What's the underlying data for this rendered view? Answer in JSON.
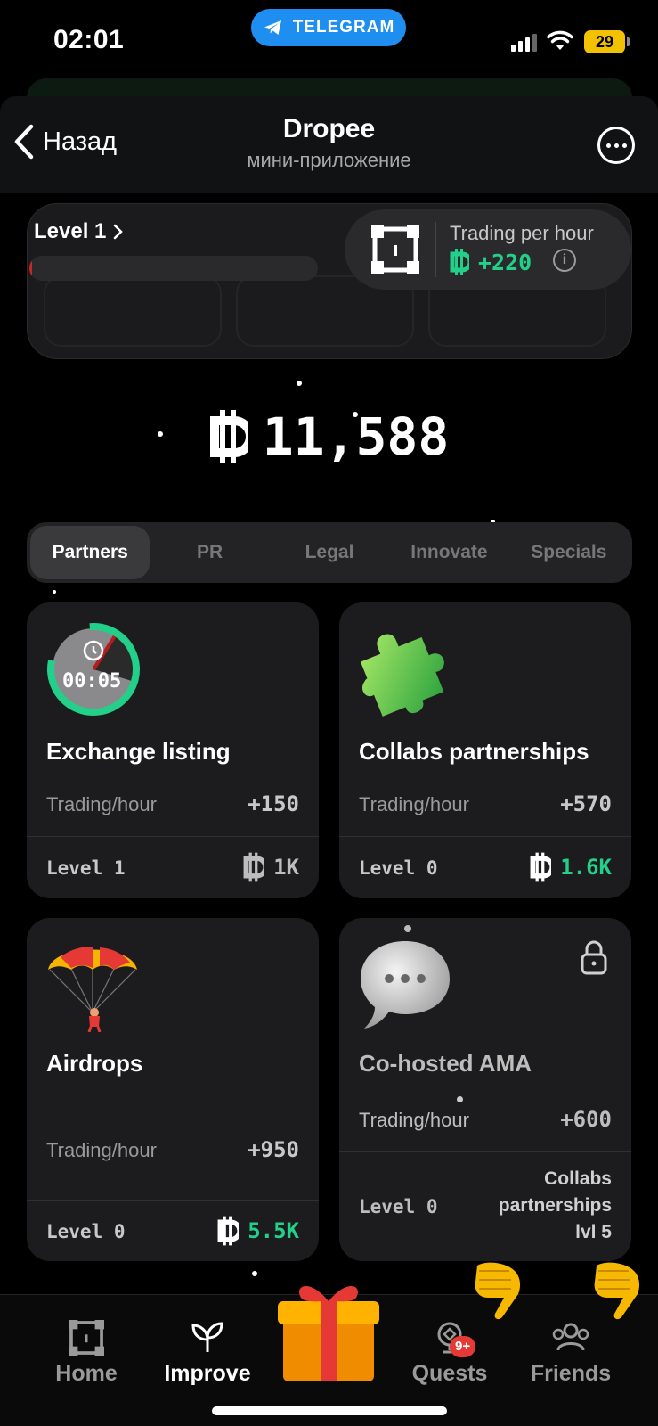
{
  "status_bar": {
    "time": "02:01",
    "app_pill": "TELEGRAM",
    "battery": "29"
  },
  "header": {
    "back_label": "Назад",
    "title": "Dropee",
    "subtitle": "мини-приложение"
  },
  "level": {
    "label": "Level 1",
    "progress": 0.01
  },
  "trading": {
    "label": "Trading per hour",
    "value": "+220"
  },
  "balance": "11,588",
  "tabs": [
    {
      "label": "Partners",
      "active": true
    },
    {
      "label": "PR",
      "active": false
    },
    {
      "label": "Legal",
      "active": false
    },
    {
      "label": "Innovate",
      "active": false
    },
    {
      "label": "Specials",
      "active": false
    }
  ],
  "cards": [
    {
      "title": "Exchange listing",
      "timer": "00:05",
      "rate_label": "Trading/hour",
      "rate": "+150",
      "level": "Level 1",
      "cost": "1K",
      "cost_color": "#bdbdbd"
    },
    {
      "title": "Collabs partnerships",
      "rate_label": "Trading/hour",
      "rate": "+570",
      "level": "Level 0",
      "cost": "1.6K",
      "cost_color": "#22d08a"
    },
    {
      "title": "Airdrops",
      "rate_label": "Trading/hour",
      "rate": "+950",
      "level": "Level 0",
      "cost": "5.5K",
      "cost_color": "#22d08a"
    },
    {
      "title": "Co-hosted AMA",
      "rate_label": "Trading/hour",
      "rate": "+600",
      "level": "Level 0",
      "req_lines": [
        "Collabs",
        "partnerships",
        "lvl 5"
      ],
      "locked": true
    }
  ],
  "nav": {
    "home": "Home",
    "improve": "Improve",
    "quests": "Quests",
    "quests_badge": "9+",
    "friends": "Friends"
  },
  "colors": {
    "accent_green": "#22d08a",
    "telegram_blue": "#1f8ef1",
    "battery_yellow": "#f2c200",
    "badge_red": "#e53935"
  }
}
